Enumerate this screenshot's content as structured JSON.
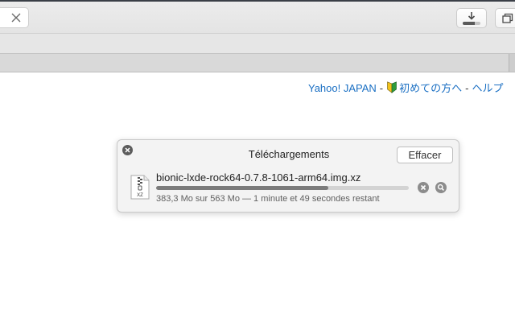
{
  "header_links": {
    "yahoo": "Yahoo! JAPAN",
    "separator": "-",
    "beginners": "初めての方へ",
    "help": "ヘルプ"
  },
  "downloads": {
    "title": "Téléchargements",
    "clear_label": "Effacer",
    "items": [
      {
        "file_name": "bionic-lxde-rock64-0.7.8-1061-arm64.img.xz",
        "file_badge": "XZ",
        "status": "383,3 Mo sur 563 Mo — 1 minute et 49 secondes restant",
        "progress": 0.68
      }
    ]
  },
  "toolbar": {
    "download_progress": 0.68
  },
  "icons": {
    "url_clear": "close-icon",
    "downloads": "download-arrow-icon",
    "tabs": "tab-overview-icon",
    "popover_close": "close-circle-icon",
    "stop": "stop-circle-icon",
    "reveal": "magnifier-icon",
    "beginner": "shoshinsha-mark-icon",
    "file": "archive-file-icon"
  },
  "colors": {
    "link": "#1a6fc3",
    "progress_fill": "#7b7b7b",
    "toolbar_bg": "#e6e6e6"
  }
}
